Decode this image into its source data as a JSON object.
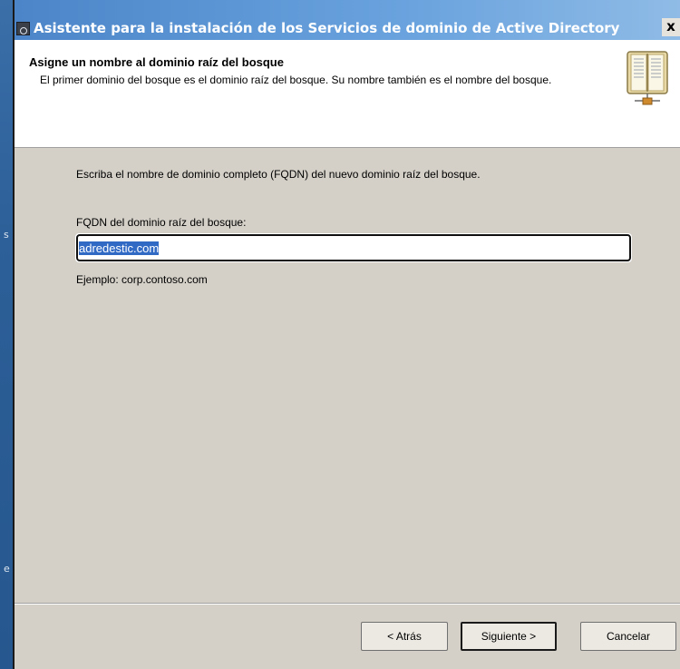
{
  "desktop": {
    "glyph_1": "s",
    "glyph_2": "e"
  },
  "window": {
    "title": "Asistente para la instalación de los Servicios de dominio de Active Directory",
    "close_label": "x",
    "icon": "wizard-app-icon"
  },
  "header": {
    "title": "Asigne un nombre al dominio raíz del bosque",
    "description": "El primer dominio del bosque es el dominio raíz del bosque. Su nombre también es el nombre del bosque.",
    "icon": "directory-book-icon"
  },
  "content": {
    "intro": "Escriba el nombre de dominio completo (FQDN) del nuevo dominio raíz del bosque.",
    "fqdn_label": "FQDN del dominio raíz del bosque:",
    "fqdn_value": "adredestic.com",
    "example": "Ejemplo: corp.contoso.com"
  },
  "buttons": {
    "back": "< Atrás",
    "next": "Siguiente >",
    "cancel": "Cancelar"
  },
  "colors": {
    "titlebar_start": "#4c86c9",
    "titlebar_end": "#8fbbe6",
    "dialog_face": "#d4d0c8",
    "selection": "#316ac5"
  }
}
